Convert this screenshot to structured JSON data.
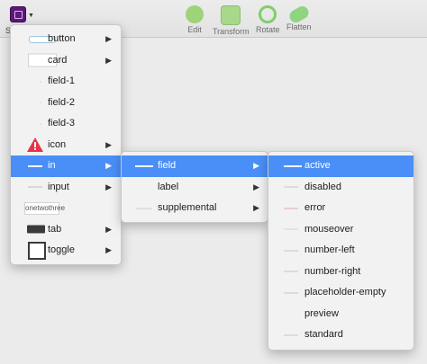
{
  "toolbar": {
    "app_label": "S",
    "tools": [
      {
        "label": "Edit",
        "icon": "edit-icon",
        "color": "#9fd37a"
      },
      {
        "label": "Transform",
        "icon": "transform-icon",
        "color": "#9fd37a"
      },
      {
        "label": "Rotate",
        "icon": "rotate-icon",
        "color": "#7fcf6a"
      },
      {
        "label": "Flatten",
        "icon": "flatten-icon",
        "color": "#7fcf6a"
      }
    ]
  },
  "menu_level1": [
    {
      "label": "button",
      "submenu": true
    },
    {
      "label": "card",
      "submenu": true
    },
    {
      "label": "field-1",
      "submenu": false
    },
    {
      "label": "field-2",
      "submenu": false
    },
    {
      "label": "field-3",
      "submenu": false
    },
    {
      "label": "icon",
      "submenu": true
    },
    {
      "label": "in",
      "submenu": true,
      "highlighted": true
    },
    {
      "label": "input",
      "submenu": true
    },
    {
      "label": "onetwothree",
      "submenu": false
    },
    {
      "label": "tab",
      "submenu": true
    },
    {
      "label": "toggle",
      "submenu": true
    }
  ],
  "menu_level2": [
    {
      "label": "field",
      "submenu": true,
      "highlighted": true
    },
    {
      "label": "label",
      "submenu": true
    },
    {
      "label": "supplemental",
      "submenu": true
    }
  ],
  "menu_level3": [
    {
      "label": "active",
      "highlighted": true
    },
    {
      "label": "disabled"
    },
    {
      "label": "error"
    },
    {
      "label": "mouseover"
    },
    {
      "label": "number-left"
    },
    {
      "label": "number-right"
    },
    {
      "label": "placeholder-empty"
    },
    {
      "label": "preview"
    },
    {
      "label": "standard"
    }
  ],
  "thumb_text": {
    "onetwothree": "onetwothree"
  },
  "colors": {
    "highlight": "#4a8ff7",
    "menu_bg": "#f2f2f2",
    "app_icon": "#5c1a7a"
  },
  "arrow_glyph": "▶"
}
